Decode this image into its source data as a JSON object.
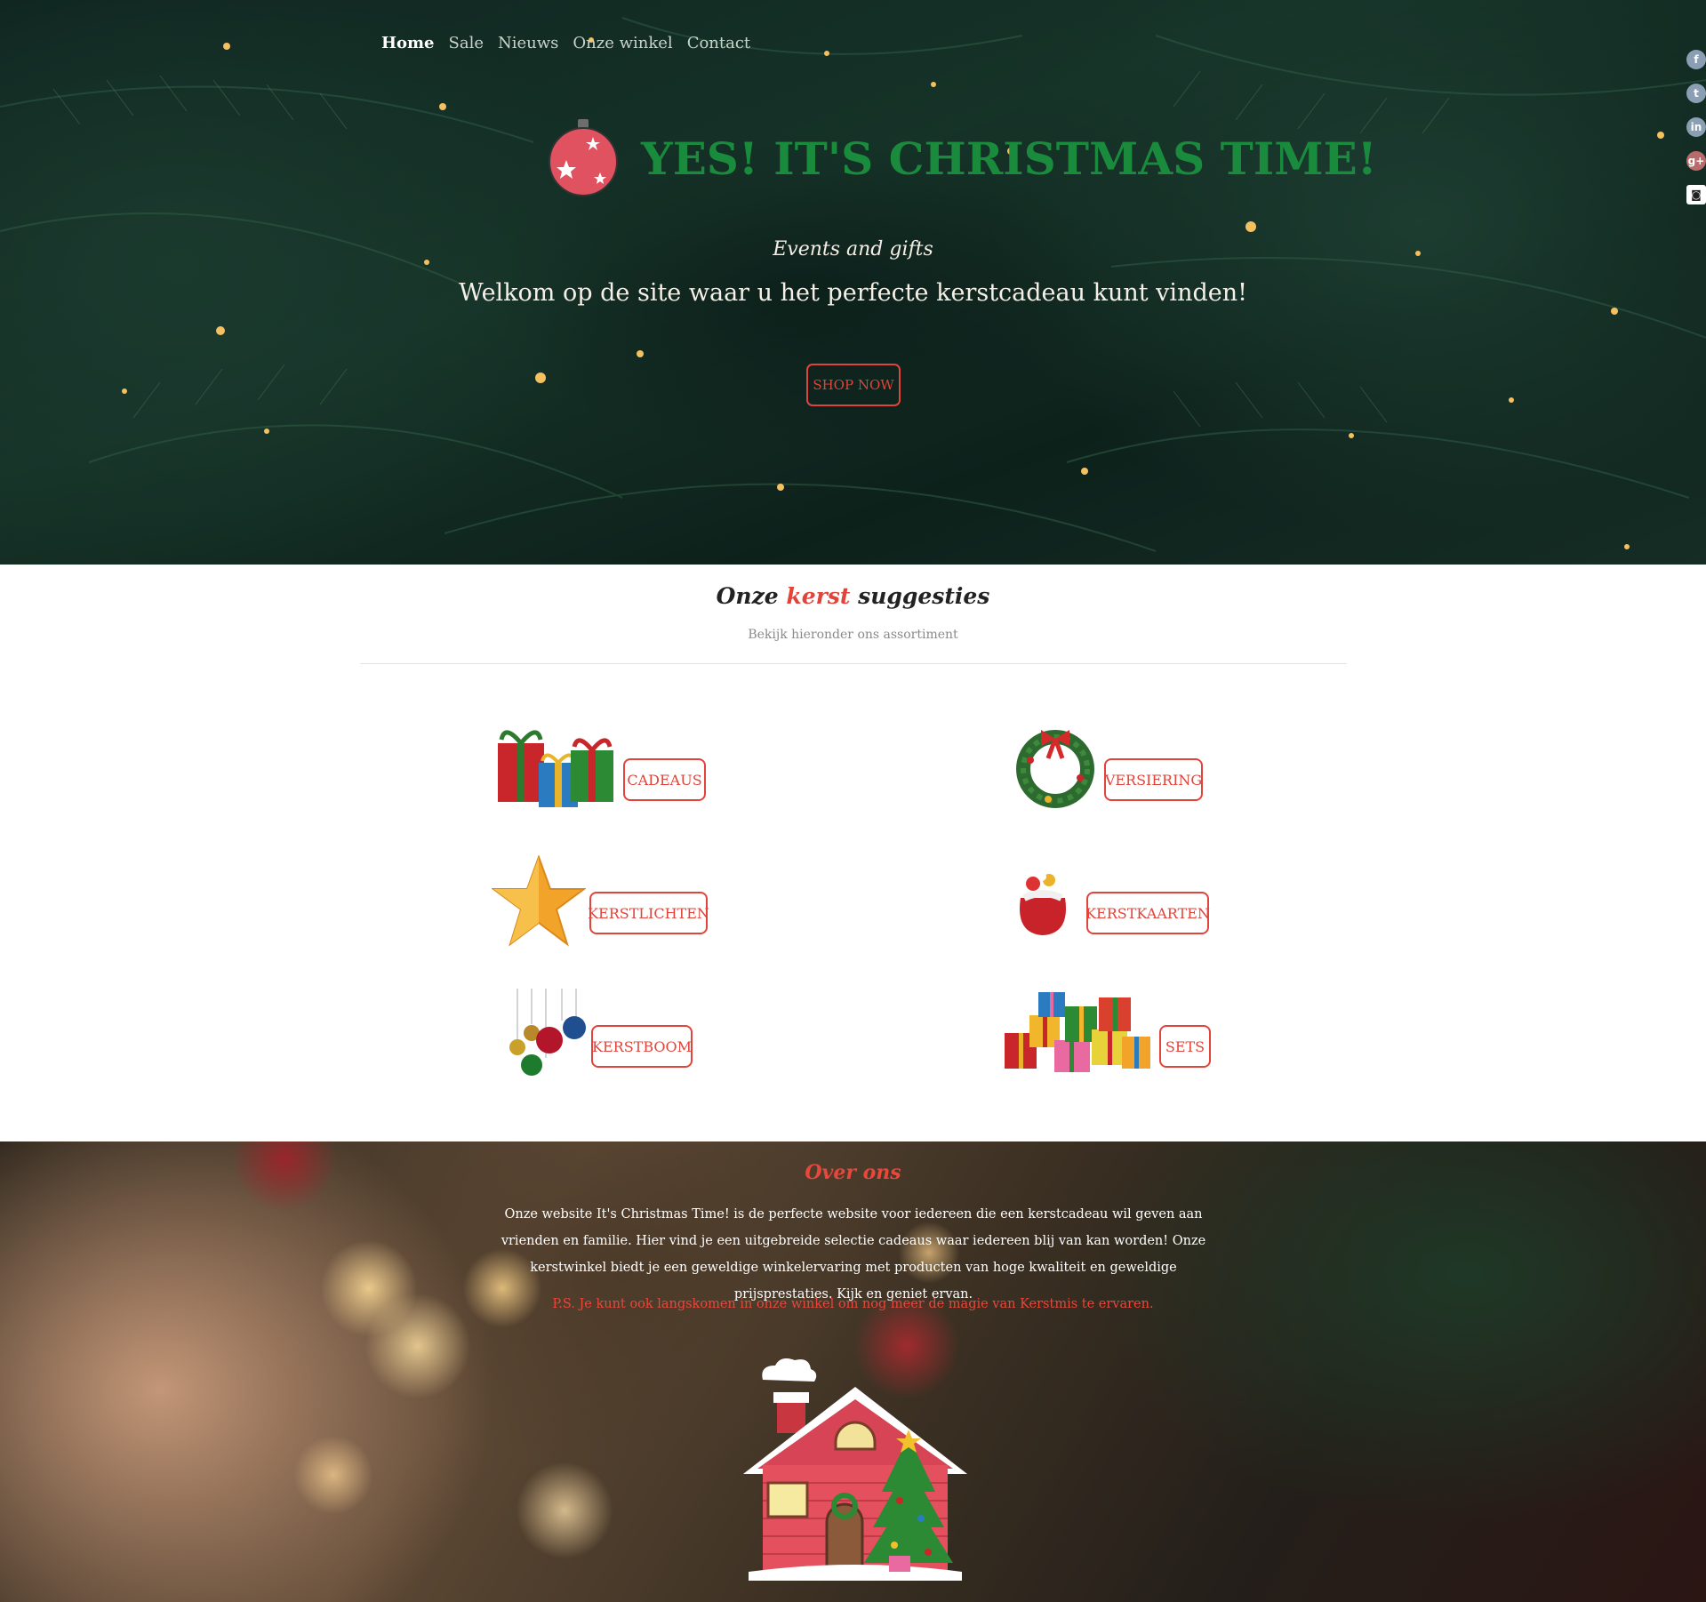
{
  "nav": {
    "items": [
      {
        "label": "Home",
        "active": true
      },
      {
        "label": "Sale",
        "active": false
      },
      {
        "label": "Nieuws",
        "active": false
      },
      {
        "label": "Onze winkel",
        "active": false
      },
      {
        "label": "Contact",
        "active": false
      }
    ]
  },
  "social": {
    "facebook": "f",
    "twitter": "t",
    "linkedin": "in",
    "googleplus": "g+",
    "instagram": "◙"
  },
  "hero": {
    "title": "YES! IT'S CHRISTMAS TIME!",
    "tagline": "Events and gifts",
    "welcome": "Welkom op de site waar u het perfecte kerstcadeau kunt vinden!",
    "cta": "SHOP NOW"
  },
  "suggestions": {
    "title_prefix": "Onze ",
    "title_accent": "kerst",
    "title_suffix": " suggesties",
    "subtitle": "Bekijk hieronder ons assortiment",
    "categories": [
      {
        "label": "CADEAUS",
        "icon": "gifts-icon"
      },
      {
        "label": "VERSIERING",
        "icon": "wreath-icon"
      },
      {
        "label": "KERSTLICHTEN",
        "icon": "star-icon"
      },
      {
        "label": "KERSTKAARTEN",
        "icon": "santa-sack-icon"
      },
      {
        "label": "KERSTBOOM",
        "icon": "baubles-icon"
      },
      {
        "label": "SETS",
        "icon": "gift-pile-icon"
      }
    ]
  },
  "about": {
    "title": "Over ons",
    "text": "Onze website It's Christmas Time! is de perfecte website voor iedereen die een kerstcadeau wil geven aan vrienden en familie. Hier vind je een uitgebreide selectie cadeaus waar iedereen blij van kan worden! Onze kerstwinkel biedt je een geweldige winkelervaring met producten van hoge kwaliteit en geweldige prijsprestaties. Kijk en geniet ervan.",
    "ps": "P.S. Je kunt ook langskomen in onze winkel om nog meer de magie van Kerstmis te ervaren."
  },
  "colors": {
    "accent": "#e0443a",
    "title_green": "#1a8a3c"
  }
}
